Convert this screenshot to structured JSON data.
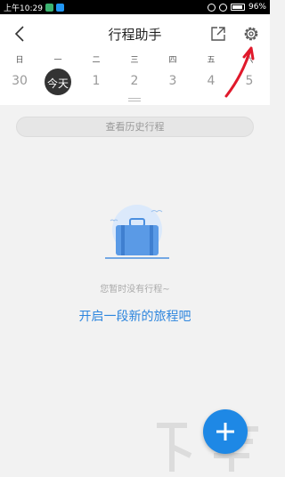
{
  "status_bar": {
    "time": "上午10:29",
    "battery": "96%"
  },
  "header": {
    "title": "行程助手",
    "icons": {
      "back": "back-arrow-icon",
      "share": "share-icon",
      "settings": "gear-icon"
    }
  },
  "calendar": {
    "weekdays": [
      "日",
      "一",
      "二",
      "三",
      "四",
      "五",
      "六"
    ],
    "dates": [
      "30",
      "今天",
      "1",
      "2",
      "3",
      "4",
      "5"
    ],
    "selected_index": 1
  },
  "history_button": "查看历史行程",
  "empty_state": {
    "message": "您暂时没有行程~",
    "action": "开启一段新的旅程吧"
  },
  "fab": {
    "icon": "plus-icon"
  },
  "colors": {
    "accent": "#2e86de",
    "fab": "#1e88e5",
    "annotation": "#e0192b"
  }
}
